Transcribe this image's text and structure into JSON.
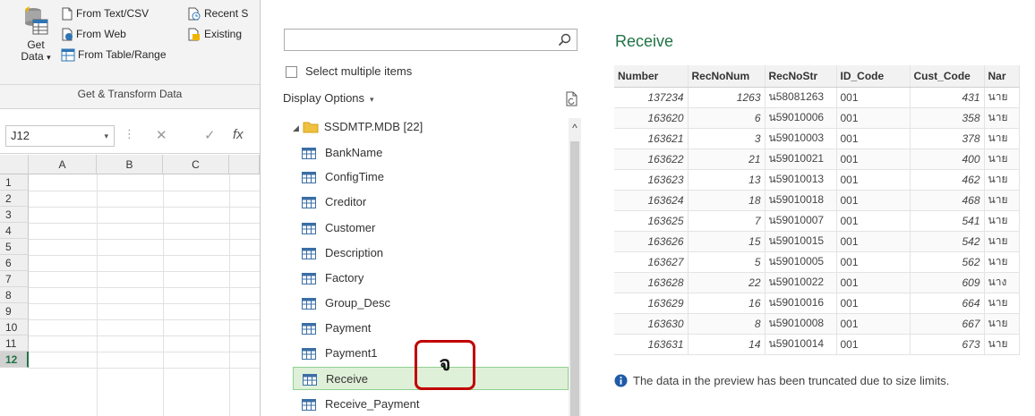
{
  "ribbon": {
    "get_data_line1": "Get",
    "get_data_line2": "Data",
    "get_data_caret": "▾",
    "from_text_csv": "From Text/CSV",
    "from_web": "From Web",
    "from_table_range": "From Table/Range",
    "recent_sources": "Recent S",
    "existing": "Existing",
    "group_label": "Get & Transform Data"
  },
  "formula_bar": {
    "name_box": "J12",
    "name_box_caret": "▾",
    "separator": "⋮",
    "cancel_glyph": "✕",
    "enter_glyph": "✓",
    "fx_glyph": "fx"
  },
  "sheet": {
    "columns": [
      "A",
      "B",
      "C"
    ],
    "rows": [
      "1",
      "2",
      "3",
      "4",
      "5",
      "6",
      "7",
      "8",
      "9",
      "10",
      "11",
      "12"
    ],
    "selected_row": "12"
  },
  "navigator": {
    "search_placeholder": "",
    "select_multiple_label": "Select multiple items",
    "display_options_label": "Display Options",
    "display_options_caret": "▾",
    "tree_expander": "◢",
    "tree_root_label": "SSDMTP.MDB [22]",
    "items": [
      {
        "label": "BankName"
      },
      {
        "label": "ConfigTime"
      },
      {
        "label": "Creditor"
      },
      {
        "label": "Customer"
      },
      {
        "label": "Description"
      },
      {
        "label": "Factory"
      },
      {
        "label": "Group_Desc"
      },
      {
        "label": "Payment"
      },
      {
        "label": "Payment1"
      },
      {
        "label": "Receive"
      },
      {
        "label": "Receive_Payment"
      }
    ],
    "selected_item": "Receive",
    "scroll_up_glyph": "^",
    "annotation_char": "จ"
  },
  "preview": {
    "title": "Receive",
    "columns": [
      "Number",
      "RecNoNum",
      "RecNoStr",
      "ID_Code",
      "Cust_Code",
      "Nar"
    ],
    "rows": [
      [
        "137234",
        "1263",
        "น58081263",
        "001",
        "431",
        "นาย"
      ],
      [
        "163620",
        "6",
        "น59010006",
        "001",
        "358",
        "นาย"
      ],
      [
        "163621",
        "3",
        "น59010003",
        "001",
        "378",
        "นาย"
      ],
      [
        "163622",
        "21",
        "น59010021",
        "001",
        "400",
        "นาย"
      ],
      [
        "163623",
        "13",
        "น59010013",
        "001",
        "462",
        "นาย"
      ],
      [
        "163624",
        "18",
        "น59010018",
        "001",
        "468",
        "นาย"
      ],
      [
        "163625",
        "7",
        "น59010007",
        "001",
        "541",
        "นาย"
      ],
      [
        "163626",
        "15",
        "น59010015",
        "001",
        "542",
        "นาย"
      ],
      [
        "163627",
        "5",
        "น59010005",
        "001",
        "562",
        "นาย"
      ],
      [
        "163628",
        "22",
        "น59010022",
        "001",
        "609",
        "นาง"
      ],
      [
        "163629",
        "16",
        "น59010016",
        "001",
        "664",
        "นาย"
      ],
      [
        "163630",
        "8",
        "น59010008",
        "001",
        "667",
        "นาย"
      ],
      [
        "163631",
        "14",
        "น59010014",
        "001",
        "673",
        "นาย"
      ]
    ],
    "truncation_note": "The data in the preview has been truncated due to size limits."
  },
  "colors": {
    "excel_green": "#217346",
    "selection_fill": "#dff0d8",
    "annotation_red": "#c00000",
    "info_blue": "#1e5ba8"
  },
  "icons": {
    "get_data": "database-table-icon",
    "text_csv": "document-icon",
    "web": "globe-icon",
    "table_range": "table-icon",
    "recent": "clock-document-icon",
    "existing": "connections-icon",
    "search": "magnifier-icon",
    "refresh_doc": "refresh-document-icon",
    "folder": "folder-icon",
    "table_item": "table-icon",
    "info": "info-icon"
  }
}
